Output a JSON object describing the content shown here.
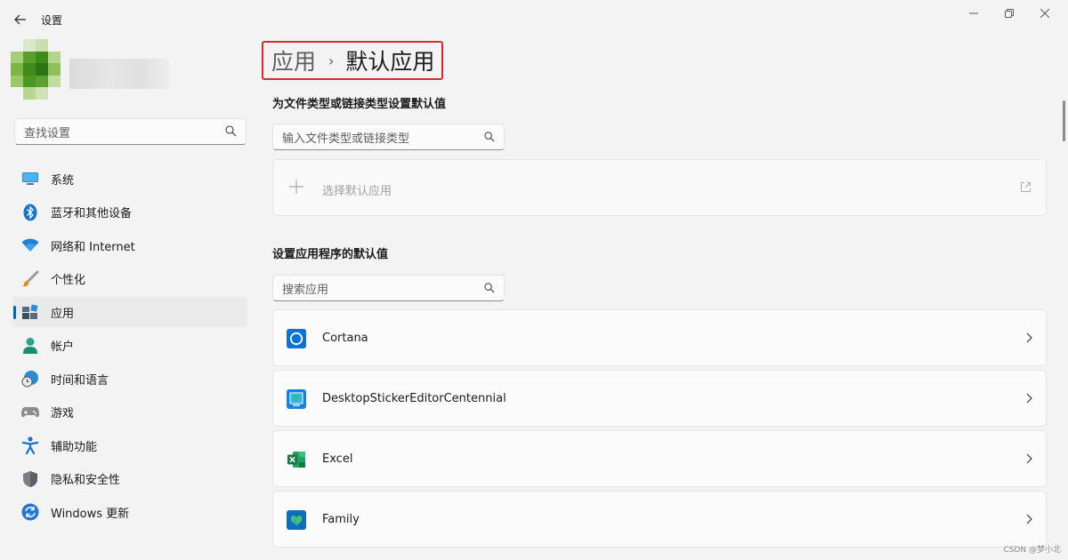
{
  "window": {
    "title": "设置"
  },
  "sidebar": {
    "search_placeholder": "查找设置",
    "items": [
      {
        "label": "系统",
        "icon": "display-icon"
      },
      {
        "label": "蓝牙和其他设备",
        "icon": "bluetooth-icon"
      },
      {
        "label": "网络和 Internet",
        "icon": "wifi-icon"
      },
      {
        "label": "个性化",
        "icon": "paintbrush-icon"
      },
      {
        "label": "应用",
        "icon": "apps-icon",
        "active": true
      },
      {
        "label": "帐户",
        "icon": "person-icon"
      },
      {
        "label": "时间和语言",
        "icon": "globe-clock-icon"
      },
      {
        "label": "游戏",
        "icon": "gamepad-icon"
      },
      {
        "label": "辅助功能",
        "icon": "accessibility-icon"
      },
      {
        "label": "隐私和安全性",
        "icon": "shield-icon"
      },
      {
        "label": "Windows 更新",
        "icon": "update-icon"
      }
    ]
  },
  "breadcrumb": {
    "parent": "应用",
    "separator": "›",
    "current": "默认应用"
  },
  "file_types": {
    "title": "为文件类型或链接类型设置默认值",
    "search_placeholder": "输入文件类型或链接类型",
    "choose_label": "选择默认应用"
  },
  "app_defaults": {
    "title": "设置应用程序的默认值",
    "search_placeholder": "搜索应用",
    "apps": [
      {
        "name": "Cortana",
        "icon": "cortana-icon"
      },
      {
        "name": "DesktopStickerEditorCentennial",
        "icon": "sticker-editor-icon"
      },
      {
        "name": "Excel",
        "icon": "excel-icon"
      },
      {
        "name": "Family",
        "icon": "family-icon"
      }
    ]
  },
  "watermark": "CSDN @梦小北",
  "colors": {
    "accent": "#0067c0",
    "highlight_border": "#e0262b",
    "background": "#f3f3f3"
  }
}
